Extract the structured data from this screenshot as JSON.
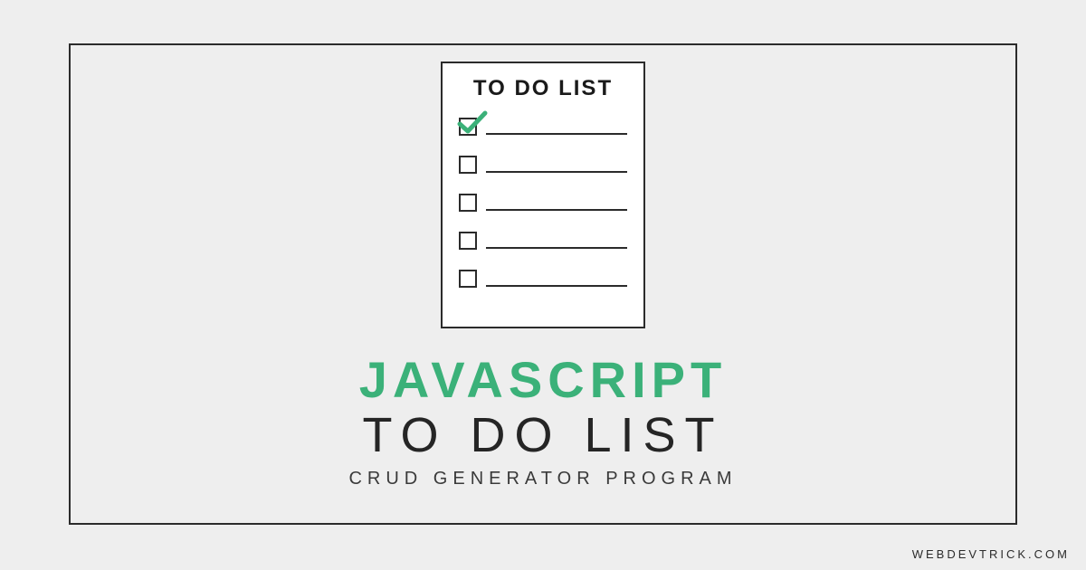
{
  "notepad": {
    "header": "TO DO LIST"
  },
  "titles": {
    "line1": "JAVASCRIPT",
    "line2": "TO DO LIST",
    "line3": "CRUD GENERATOR PROGRAM"
  },
  "watermark": "WEBDEVTRICK.COM"
}
